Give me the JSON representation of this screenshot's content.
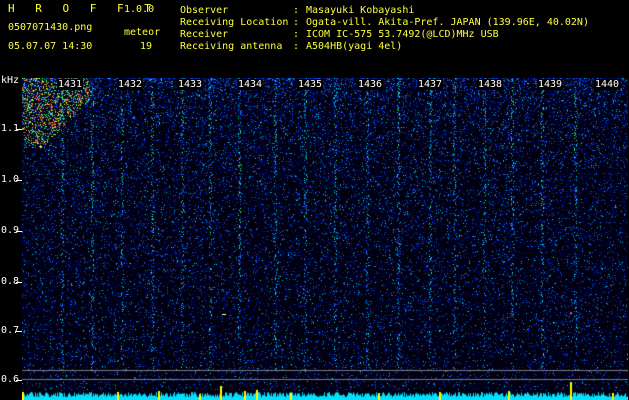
{
  "header": {
    "app_name": "H R O F F T",
    "version": "1.0.0",
    "filename": "0507071430.png",
    "meteor_label": "meteor",
    "datetime": "05.07.07 14:30",
    "meteor_count": "19",
    "info": [
      {
        "label": "Observer",
        "sep": ":",
        "value": "Masayuki Kobayashi"
      },
      {
        "label": "Receiving Location",
        "sep": ":",
        "value": "Ogata-vill. Akita-Pref. JAPAN (139.96E, 40.02N)"
      },
      {
        "label": "Receiver",
        "sep": ":",
        "value": "ICOM IC-575 53.7492(@LCD)MHz USB"
      },
      {
        "label": "Receiving antenna",
        "sep": ":",
        "value": "A504HB(yagi 4el)"
      }
    ]
  },
  "spectrogram": {
    "unit": "kHz",
    "y_labels": [
      "1.1",
      "1.0",
      "0.9",
      "0.8",
      "0.7",
      "0.6"
    ],
    "time_labels": [
      "1431",
      "1432",
      "1433",
      "1434",
      "1435",
      "1436",
      "1437",
      "1438",
      "1439",
      "1440"
    ],
    "colors": {
      "background": "#000010",
      "noise_low": "#0018a0",
      "noise_mid": "#1a5cff",
      "hit": "#00e0ff",
      "strong": "#40ff60",
      "peak": "#ffff00",
      "baseline": "#00e0ff"
    }
  }
}
